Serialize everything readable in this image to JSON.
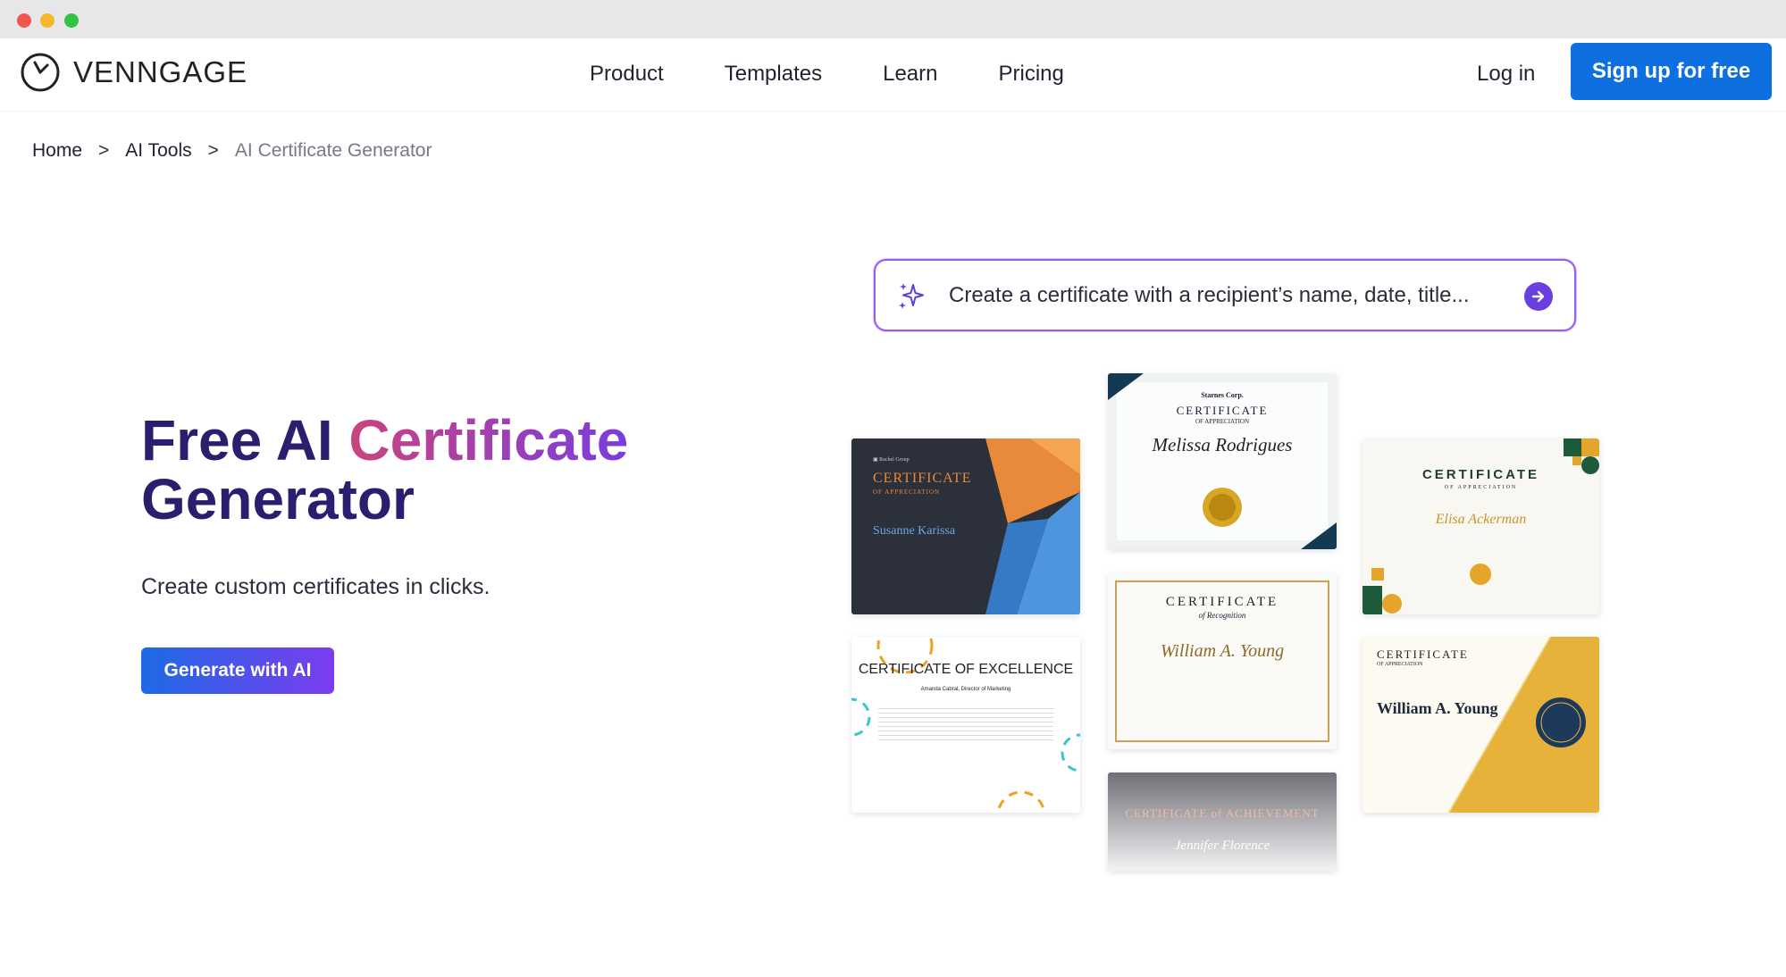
{
  "brand": {
    "name": "VENNGAGE"
  },
  "nav": {
    "items": [
      "Product",
      "Templates",
      "Learn",
      "Pricing"
    ]
  },
  "header": {
    "login_label": "Log in",
    "signup_label": "Sign up for free"
  },
  "breadcrumb": {
    "items": [
      "Home",
      "AI Tools",
      "AI Certificate Generator"
    ],
    "separator": ">"
  },
  "hero": {
    "title_part1": "Free AI ",
    "title_part2": "Certificate",
    "title_part3": "Generator",
    "subtitle": "Create custom certificates in clicks.",
    "cta_label": "Generate with AI"
  },
  "prompt": {
    "placeholder": "Create a certificate with a recipient’s name, date, title..."
  },
  "icons": {
    "logo": "clock-circle-icon",
    "prompt": "sparkle-icon",
    "submit": "arrow-right-icon"
  },
  "colors": {
    "accent": "#0e6fe0",
    "title": "#2c1e6e",
    "prompt_border": "#9a5cf0"
  },
  "templates": [
    {
      "title": "CERTIFICATE",
      "subtitle": "OF APPRECIATION",
      "name": "Susanne Karissa"
    },
    {
      "org": "Starnes Corp.",
      "title": "CERTIFICATE",
      "subtitle": "OF APPRECIATION",
      "name": "Melissa Rodrigues"
    },
    {
      "title": "CERTIFICATE",
      "subtitle": "OF APPRECIATION",
      "name": "Elisa Ackerman"
    },
    {
      "title": "CERTIFICATE OF EXCELLENCE",
      "name": "Amanda Cabral, Director of Marketing"
    },
    {
      "title": "CERTIFICATE",
      "subtitle": "of Recognition",
      "name": "William A. Young"
    },
    {
      "title": "CERTIFICATE",
      "subtitle": "OF APPRECIATION",
      "name": "William A. Young"
    },
    {
      "title": "CERTIFICATE of ACHIEVEMENT",
      "name": "Jennifer Florence"
    }
  ]
}
